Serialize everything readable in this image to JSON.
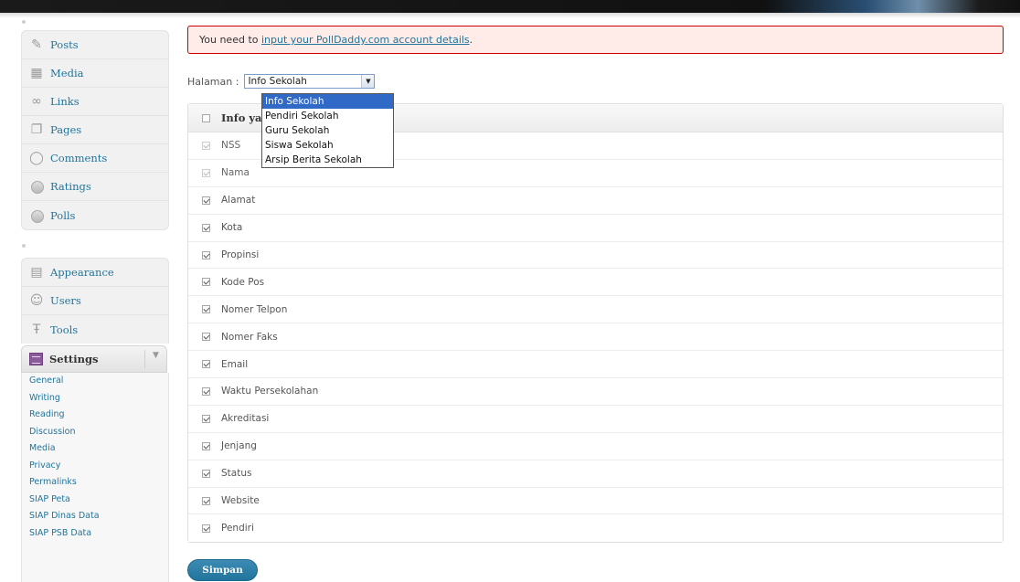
{
  "notice": {
    "prefix": "You need to ",
    "link": "input your PollDaddy.com account details",
    "suffix": "."
  },
  "sidebar": {
    "group1": [
      {
        "label": "Posts",
        "icon": "pin-icon"
      },
      {
        "label": "Media",
        "icon": "media-icon"
      },
      {
        "label": "Links",
        "icon": "link-icon"
      },
      {
        "label": "Pages",
        "icon": "pages-icon"
      },
      {
        "label": "Comments",
        "icon": "comment-icon"
      },
      {
        "label": "Ratings",
        "icon": "ratings-icon"
      },
      {
        "label": "Polls",
        "icon": "polls-icon"
      }
    ],
    "group2": [
      {
        "label": "Appearance",
        "icon": "appearance-icon"
      },
      {
        "label": "Users",
        "icon": "users-icon"
      },
      {
        "label": "Tools",
        "icon": "tools-icon"
      }
    ],
    "settings": {
      "label": "Settings",
      "icon": "settings-icon",
      "items": [
        "General",
        "Writing",
        "Reading",
        "Discussion",
        "Media",
        "Privacy",
        "Permalinks",
        "SIAP Peta",
        "SIAP Dinas Data",
        "SIAP PSB Data"
      ]
    }
  },
  "page_select": {
    "label": "Halaman :",
    "value": "Info Sekolah",
    "options": [
      "Info Sekolah",
      "Pendiri Sekolah",
      "Guru Sekolah",
      "Siswa Sekolah",
      "Arsip Berita Sekolah"
    ],
    "selected_index": 0
  },
  "table": {
    "header": "Info ya",
    "rows": [
      {
        "label": "NSS",
        "checked": true,
        "disabled": true
      },
      {
        "label": "Nama",
        "checked": true,
        "disabled": true
      },
      {
        "label": "Alamat",
        "checked": true,
        "disabled": false
      },
      {
        "label": "Kota",
        "checked": true,
        "disabled": false
      },
      {
        "label": "Propinsi",
        "checked": true,
        "disabled": false
      },
      {
        "label": "Kode Pos",
        "checked": true,
        "disabled": false
      },
      {
        "label": "Nomer Telpon",
        "checked": true,
        "disabled": false
      },
      {
        "label": "Nomer Faks",
        "checked": true,
        "disabled": false
      },
      {
        "label": "Email",
        "checked": true,
        "disabled": false
      },
      {
        "label": "Waktu Persekolahan",
        "checked": true,
        "disabled": false
      },
      {
        "label": "Akreditasi",
        "checked": true,
        "disabled": false
      },
      {
        "label": "Jenjang",
        "checked": true,
        "disabled": false
      },
      {
        "label": "Status",
        "checked": true,
        "disabled": false
      },
      {
        "label": "Website",
        "checked": true,
        "disabled": false
      },
      {
        "label": "Pendiri",
        "checked": true,
        "disabled": false
      }
    ]
  },
  "save_label": "Simpan",
  "colors": {
    "link": "#21759b",
    "notice_bg": "#ffebe8",
    "notice_border": "#cc0000",
    "dropdown_highlight": "#3169c6",
    "button": "#21759b"
  }
}
